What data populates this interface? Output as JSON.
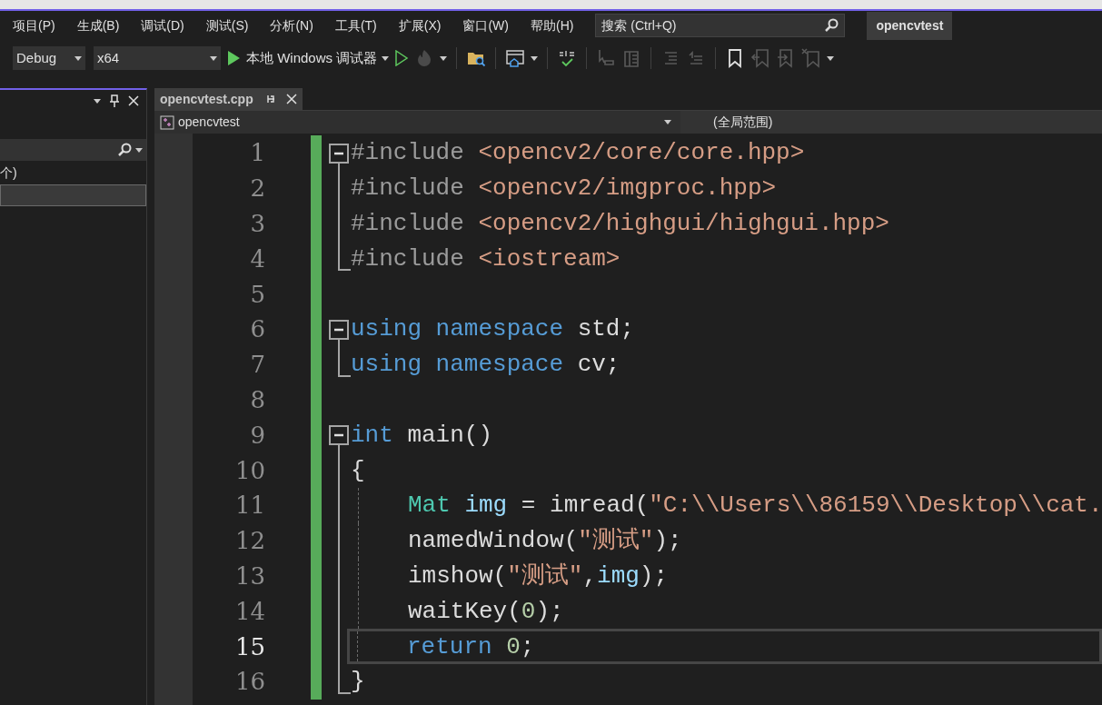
{
  "menu": [
    "项目(P)",
    "生成(B)",
    "调试(D)",
    "测试(S)",
    "分析(N)",
    "工具(T)",
    "扩展(X)",
    "窗口(W)",
    "帮助(H)"
  ],
  "search": {
    "placeholder": "搜索 (Ctrl+Q)"
  },
  "solution_name": "opencvtest",
  "toolbar": {
    "configuration": "Debug",
    "platform": "x64",
    "debugger": "本地 Windows 调试器"
  },
  "left_panel": {
    "item_text": "个)"
  },
  "tabs": [
    {
      "label": "opencvtest.cpp",
      "selected": true
    }
  ],
  "nav_bar": {
    "project": "opencvtest",
    "scope": "(全局范围)"
  },
  "code_lines": [
    {
      "number": "1",
      "kind": "fold_start",
      "indent_guide": false,
      "current": false,
      "tokens": [
        {
          "kind": "pre",
          "text": "#include "
        },
        {
          "kind": "str",
          "text": "<opencv2/core/core.hpp>"
        }
      ]
    },
    {
      "number": "2",
      "kind": "fold_inner",
      "indent_guide": false,
      "current": false,
      "tokens": [
        {
          "kind": "pre",
          "text": "#include "
        },
        {
          "kind": "str",
          "text": "<opencv2/imgproc.hpp>"
        }
      ]
    },
    {
      "number": "3",
      "kind": "fold_inner",
      "indent_guide": false,
      "current": false,
      "tokens": [
        {
          "kind": "pre",
          "text": "#include "
        },
        {
          "kind": "str",
          "text": "<opencv2/highgui/highgui.hpp>"
        }
      ]
    },
    {
      "number": "4",
      "kind": "fold_end",
      "indent_guide": false,
      "current": false,
      "tokens": [
        {
          "kind": "pre",
          "text": "#include "
        },
        {
          "kind": "str",
          "text": "<iostream>"
        }
      ]
    },
    {
      "number": "5",
      "kind": "plain",
      "indent_guide": false,
      "current": false
    },
    {
      "number": "6",
      "kind": "fold_start",
      "indent_guide": false,
      "current": false,
      "tokens": [
        {
          "kind": "kw",
          "text": "using namespace"
        },
        {
          "kind": "plain",
          "text": " std;"
        }
      ]
    },
    {
      "number": "7",
      "kind": "fold_end",
      "indent_guide": false,
      "current": false,
      "tokens": [
        {
          "kind": "kw",
          "text": "using namespace"
        },
        {
          "kind": "plain",
          "text": " cv;"
        }
      ]
    },
    {
      "number": "8",
      "kind": "plain",
      "indent_guide": false,
      "current": false
    },
    {
      "number": "9",
      "kind": "fold_start",
      "indent_guide": false,
      "current": false,
      "tokens": [
        {
          "kind": "kw",
          "text": "int"
        },
        {
          "kind": "plain",
          "text": " main()"
        }
      ]
    },
    {
      "number": "10",
      "kind": "fold_inner",
      "indent_guide": false,
      "current": false,
      "tokens": [
        {
          "kind": "plain",
          "text": "{"
        }
      ]
    },
    {
      "number": "11",
      "kind": "fold_inner",
      "indent_guide": true,
      "current": false,
      "tokens": [
        {
          "kind": "type",
          "text": "Mat"
        },
        {
          "kind": "var",
          "text": " img"
        },
        {
          "kind": "plain",
          "text": " = imread("
        },
        {
          "kind": "str",
          "text": "\"C:\\\\Users\\\\86159\\\\Desktop\\\\cat."
        }
      ]
    },
    {
      "number": "12",
      "kind": "fold_inner",
      "indent_guide": true,
      "current": false,
      "tokens": [
        {
          "kind": "plain",
          "text": "namedWindow("
        },
        {
          "kind": "str",
          "text": "\"测试\""
        },
        {
          "kind": "plain",
          "text": ");"
        }
      ]
    },
    {
      "number": "13",
      "kind": "fold_inner",
      "indent_guide": true,
      "current": false,
      "tokens": [
        {
          "kind": "plain",
          "text": "imshow("
        },
        {
          "kind": "str",
          "text": "\"测试\""
        },
        {
          "kind": "plain",
          "text": ","
        },
        {
          "kind": "var",
          "text": "img"
        },
        {
          "kind": "plain",
          "text": ");"
        }
      ]
    },
    {
      "number": "14",
      "kind": "fold_inner",
      "indent_guide": true,
      "current": false,
      "tokens": [
        {
          "kind": "plain",
          "text": "waitKey("
        },
        {
          "kind": "num",
          "text": "0"
        },
        {
          "kind": "plain",
          "text": ");"
        }
      ]
    },
    {
      "number": "15",
      "kind": "fold_inner",
      "indent_guide": true,
      "current": true,
      "tokens": [
        {
          "kind": "kw",
          "text": "return"
        },
        {
          "kind": "num",
          "text": " 0"
        },
        {
          "kind": "plain",
          "text": ";"
        }
      ]
    },
    {
      "number": "16",
      "kind": "fold_end",
      "indent_guide": false,
      "current": false,
      "tokens": [
        {
          "kind": "plain",
          "text": "}"
        }
      ]
    }
  ]
}
